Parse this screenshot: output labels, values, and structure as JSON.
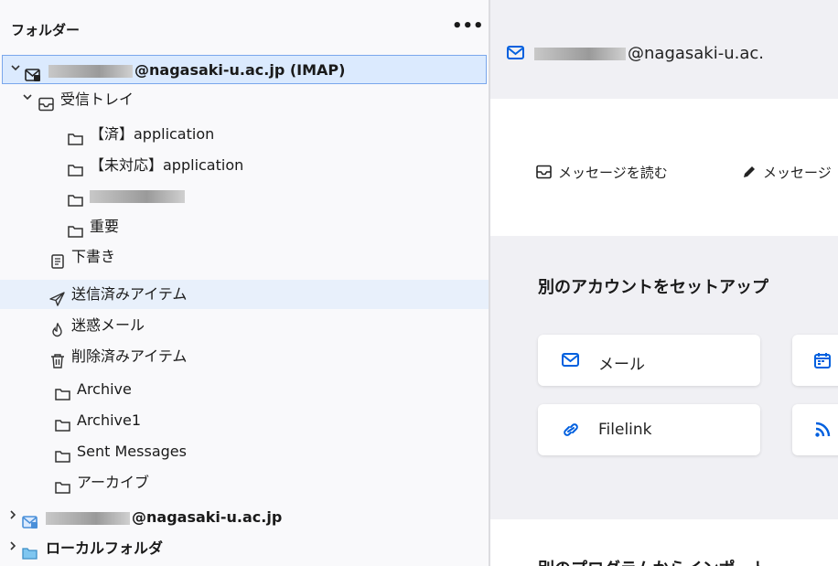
{
  "sidebar": {
    "title": "フォルダー",
    "menu_glyph": "•••",
    "account1": {
      "email": "@nagasaki-u.ac.jp (IMAP)"
    },
    "folders": {
      "inbox": "受信トレイ",
      "done_app": "【済】application",
      "pending_app": "【未対応】application",
      "important": "重要",
      "drafts": "下書き",
      "sent": "送信済みアイテム",
      "junk": "迷惑メール",
      "deleted": "削除済みアイテム",
      "archive": "Archive",
      "archive1": "Archive1",
      "sent_messages": "Sent Messages",
      "archive_jp": "アーカイブ"
    },
    "account2": {
      "email": "@nagasaki-u.ac.jp"
    },
    "local": "ローカルフォルダ"
  },
  "main": {
    "account_email": "@nagasaki-u.ac.",
    "read_messages": "メッセージを読む",
    "write_message": "メッセージ",
    "setup_title": "別のアカウントをセットアップ",
    "mail_card": "メール",
    "filelink_card": "Filelink",
    "import_title": "別のプログラムからインポート"
  },
  "colors": {
    "accent": "#0060df",
    "selected_bg": "#dbeafe"
  }
}
